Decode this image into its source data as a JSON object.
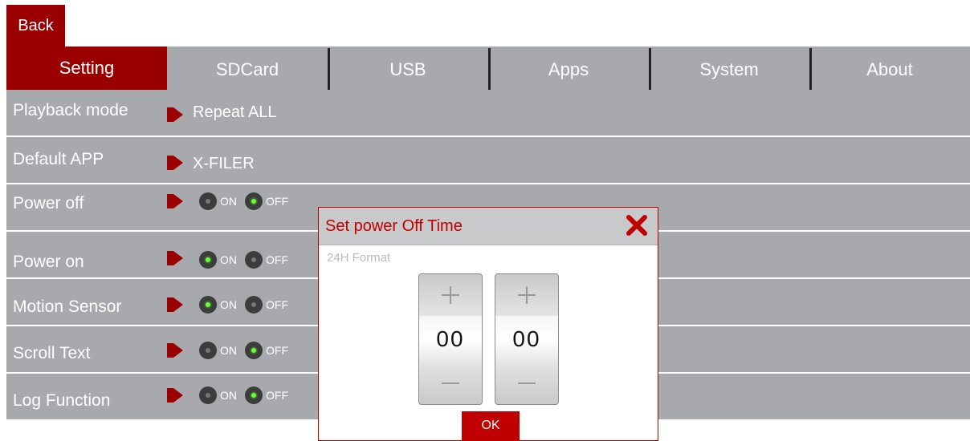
{
  "back_label": "Back",
  "tabs": [
    {
      "label": "Setting",
      "active": true
    },
    {
      "label": "SDCard",
      "active": false
    },
    {
      "label": "USB",
      "active": false
    },
    {
      "label": "Apps",
      "active": false
    },
    {
      "label": "System",
      "active": false
    },
    {
      "label": "About",
      "active": false
    }
  ],
  "settings": {
    "playback_mode": {
      "label": "Playback mode",
      "value": "Repeat ALL"
    },
    "default_app": {
      "label": "Default APP",
      "value": "X-FILER"
    },
    "power_off": {
      "label": "Power off",
      "on_label": "ON",
      "off_label": "OFF",
      "state": "OFF"
    },
    "power_on": {
      "label": "Power on",
      "on_label": "ON",
      "off_label": "OFF",
      "state": "ON"
    },
    "motion_sensor": {
      "label": "Motion Sensor",
      "on_label": "ON",
      "off_label": "OFF",
      "state": "ON"
    },
    "scroll_text": {
      "label": "Scroll Text",
      "on_label": "ON",
      "off_label": "OFF",
      "state": "OFF"
    },
    "log_function": {
      "label": "Log Function",
      "on_label": "ON",
      "off_label": "OFF",
      "state": "OFF"
    }
  },
  "dialog": {
    "title": "Set power Off Time",
    "format_label": "24H Format",
    "hours": "00",
    "minutes": "00",
    "ok_label": "OK"
  },
  "colors": {
    "accent": "#9b0000",
    "dialog_accent": "#c00000",
    "row_bg": "#a7a9ac",
    "led_on": "#66ff33"
  }
}
